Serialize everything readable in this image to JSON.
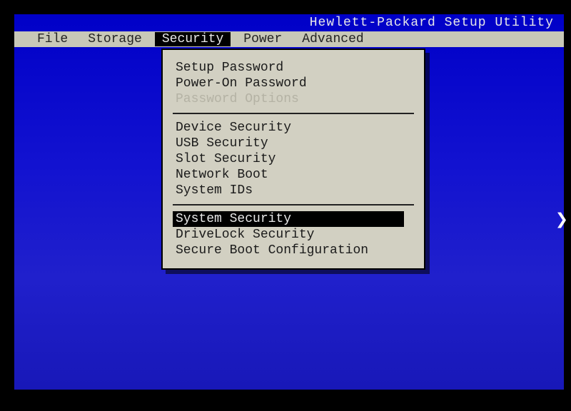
{
  "title": "Hewlett-Packard Setup Utility",
  "tabs": {
    "file": "File",
    "storage": "Storage",
    "security": "Security",
    "power": "Power",
    "advanced": "Advanced"
  },
  "security_menu": {
    "setup_password": "Setup Password",
    "poweron_password": "Power-On Password",
    "password_options": "Password Options",
    "device_security": "Device Security",
    "usb_security": "USB Security",
    "slot_security": "Slot Security",
    "network_boot": "Network Boot",
    "system_ids": "System IDs",
    "system_security": "System Security",
    "drivelock_security": "DriveLock Security",
    "secure_boot_configuration": "Secure Boot Configuration"
  }
}
